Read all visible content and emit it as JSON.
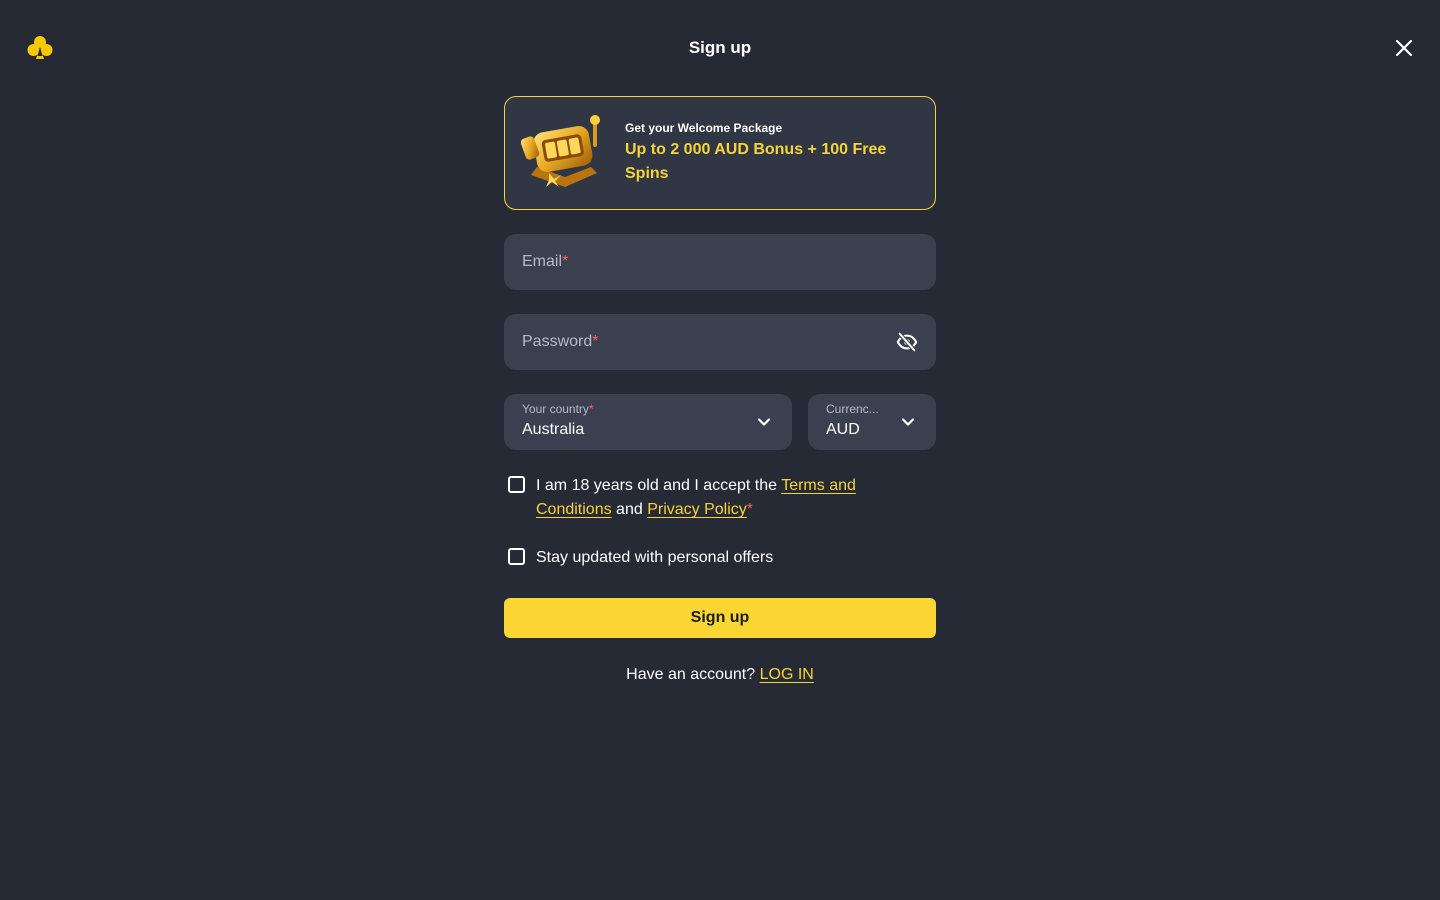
{
  "header": {
    "title": "Sign up"
  },
  "promo": {
    "kicker": "Get your Welcome Package",
    "offer": "Up to 2 000 AUD Bonus + 100 Free Spins"
  },
  "form": {
    "email_label": "Email",
    "password_label": "Password",
    "required_mark": "*",
    "country": {
      "label": "Your country",
      "value": "Australia"
    },
    "currency": {
      "label": "Currenc...",
      "value": "AUD"
    },
    "terms": {
      "text_before": "I am 18 years old and I accept the ",
      "terms_link": "Terms and Conditions",
      "text_middle": " and ",
      "privacy_link": "Privacy Policy",
      "checked": false
    },
    "offers": {
      "text": "Stay updated with personal offers",
      "checked": false
    },
    "submit_label": "Sign up"
  },
  "login": {
    "prompt": "Have an account? ",
    "link": "LOG IN"
  },
  "colors": {
    "background": "#262a35",
    "accent": "#f6d33a",
    "field": "#3b4050",
    "required": "#ff5d5d"
  }
}
